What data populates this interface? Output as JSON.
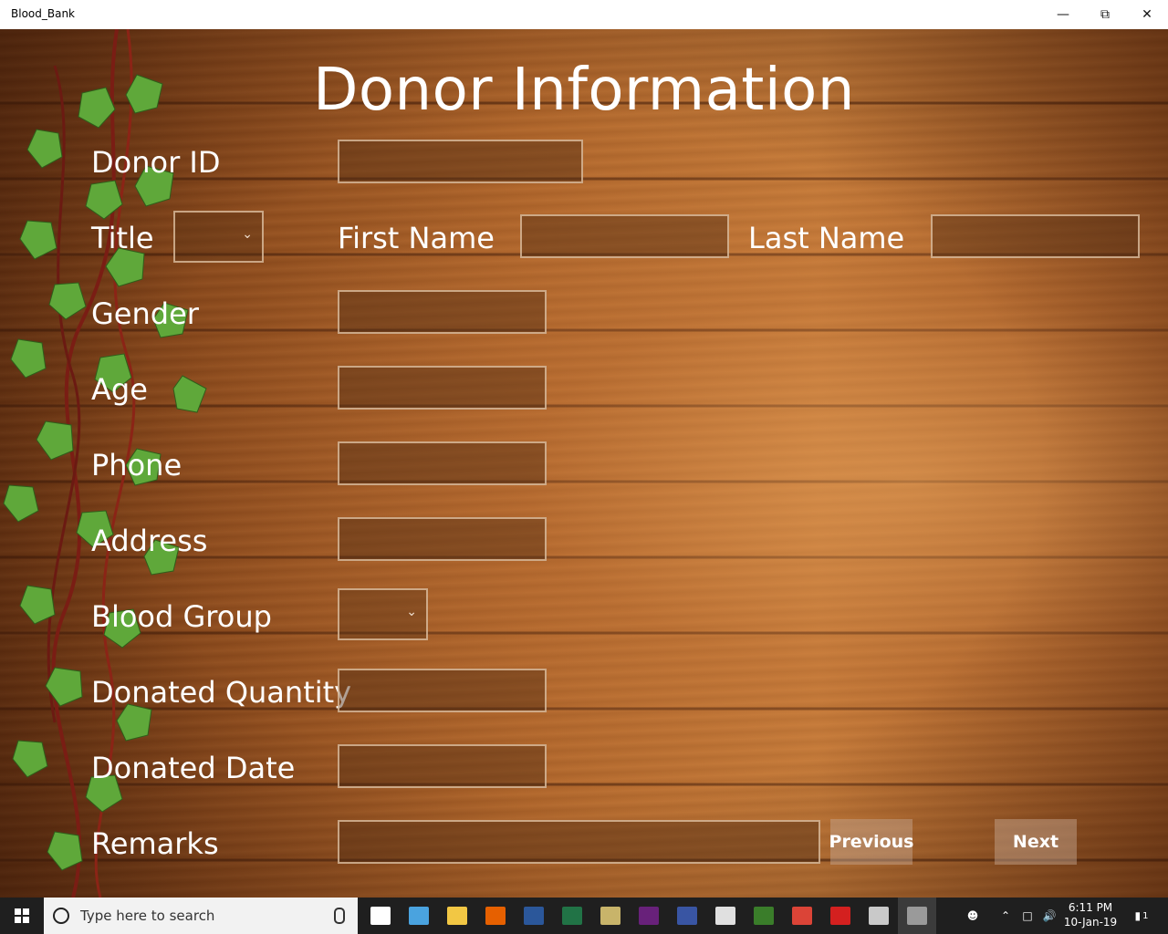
{
  "window": {
    "title": "Blood_Bank",
    "minimize": "—",
    "restore": "⧉",
    "close": "✕"
  },
  "form": {
    "heading": "Donor Information",
    "labels": {
      "donor_id": "Donor ID",
      "title": "Title",
      "first_name": "First Name",
      "last_name": "Last Name",
      "gender": "Gender",
      "age": "Age",
      "phone": "Phone",
      "address": "Address",
      "blood_group": "Blood Group",
      "donated_quantity": "Donated Quantity",
      "donated_date": "Donated Date",
      "remarks": "Remarks"
    },
    "values": {
      "donor_id": "",
      "first_name": "",
      "last_name": "",
      "gender": "",
      "age": "",
      "phone": "",
      "address": "",
      "donated_quantity": "",
      "donated_date": "",
      "remarks": ""
    },
    "buttons": {
      "previous": "Previous",
      "next": "Next"
    }
  },
  "taskbar": {
    "search_placeholder": "Type here to search",
    "time": "6:11 PM",
    "date": "10-Jan-19",
    "notification_count": "1",
    "apps": [
      {
        "icon": "task-view-icon",
        "color": "#ffffff"
      },
      {
        "icon": "remote-desktop-icon",
        "color": "#4aa3df"
      },
      {
        "icon": "file-explorer-icon",
        "color": "#f2c744"
      },
      {
        "icon": "firefox-icon",
        "color": "#e66000"
      },
      {
        "icon": "word-icon",
        "color": "#2b579a"
      },
      {
        "icon": "excel-icon",
        "color": "#217346"
      },
      {
        "icon": "sql-tool-icon",
        "color": "#c8b46a"
      },
      {
        "icon": "visual-studio-icon",
        "color": "#68217a"
      },
      {
        "icon": "visio-icon",
        "color": "#3955a3"
      },
      {
        "icon": "paint-icon",
        "color": "#e0e0e0"
      },
      {
        "icon": "eye-app-icon",
        "color": "#3a7d2a"
      },
      {
        "icon": "chrome-icon",
        "color": "#db4437"
      },
      {
        "icon": "acrobat-icon",
        "color": "#d4201f"
      },
      {
        "icon": "paint-3d-icon",
        "color": "#c9c9c9"
      },
      {
        "icon": "blood-bank-app-icon",
        "color": "#9a9a9a"
      }
    ]
  }
}
